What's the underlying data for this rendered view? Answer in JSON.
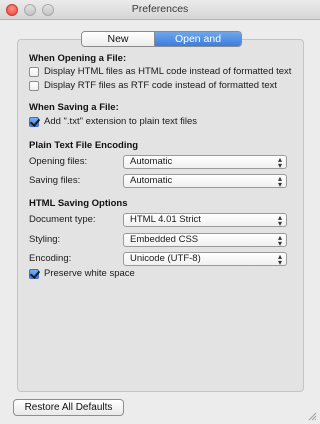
{
  "window": {
    "title": "Preferences"
  },
  "tabs": [
    {
      "label": "New Document",
      "active": false
    },
    {
      "label": "Open and Save",
      "active": true
    }
  ],
  "opening": {
    "heading": "When Opening a File:",
    "options": [
      {
        "label": "Display HTML files as HTML code instead of formatted text",
        "checked": false
      },
      {
        "label": "Display RTF files as RTF code instead of formatted text",
        "checked": false
      }
    ]
  },
  "saving": {
    "heading": "When Saving a File:",
    "options": [
      {
        "label": "Add \".txt\" extension to plain text files",
        "checked": true
      }
    ]
  },
  "encoding": {
    "heading": "Plain Text File Encoding",
    "opening_label": "Opening files:",
    "opening_value": "Automatic",
    "saving_label": "Saving files:",
    "saving_value": "Automatic"
  },
  "html_saving": {
    "heading": "HTML Saving Options",
    "doctype_label": "Document type:",
    "doctype_value": "HTML 4.01 Strict",
    "styling_label": "Styling:",
    "styling_value": "Embedded CSS",
    "encoding_label": "Encoding:",
    "encoding_value": "Unicode (UTF-8)",
    "preserve_label": "Preserve white space",
    "preserve_checked": true
  },
  "footer": {
    "restore_label": "Restore All Defaults"
  }
}
